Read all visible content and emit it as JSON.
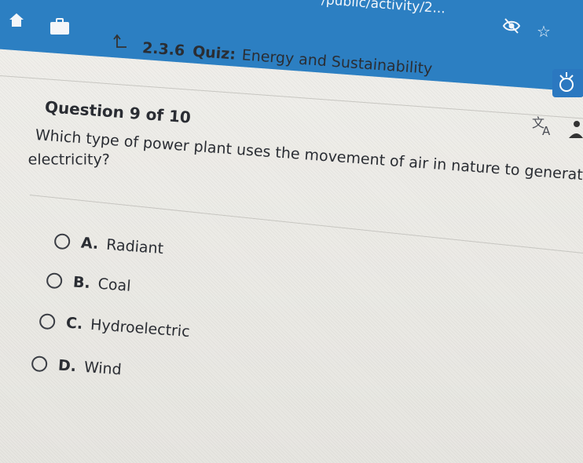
{
  "browser": {
    "url": "/public/activity/2..."
  },
  "header": {
    "course_number": "2.3.6",
    "course_type": "Quiz:",
    "course_title": "Energy and Sustainability"
  },
  "question": {
    "counter": "Question 9 of 10",
    "text_line1": "Which type of power plant uses the movement of air in nature to generate",
    "text_line2": "electricity?"
  },
  "options": [
    {
      "letter": "A.",
      "label": "Radiant"
    },
    {
      "letter": "B.",
      "label": "Coal"
    },
    {
      "letter": "C.",
      "label": "Hydroelectric"
    },
    {
      "letter": "D.",
      "label": "Wind"
    }
  ],
  "icons": {
    "home": "home-icon",
    "briefcase": "briefcase-icon",
    "up": "arrow-up-icon",
    "eye": "eye-slash-icon",
    "star": "star-icon",
    "translate": "translate-icon",
    "person": "person-icon"
  },
  "colors": {
    "browser_bar": "#2c7fc2",
    "text": "#2a2d33",
    "background": "#ecebe7"
  }
}
